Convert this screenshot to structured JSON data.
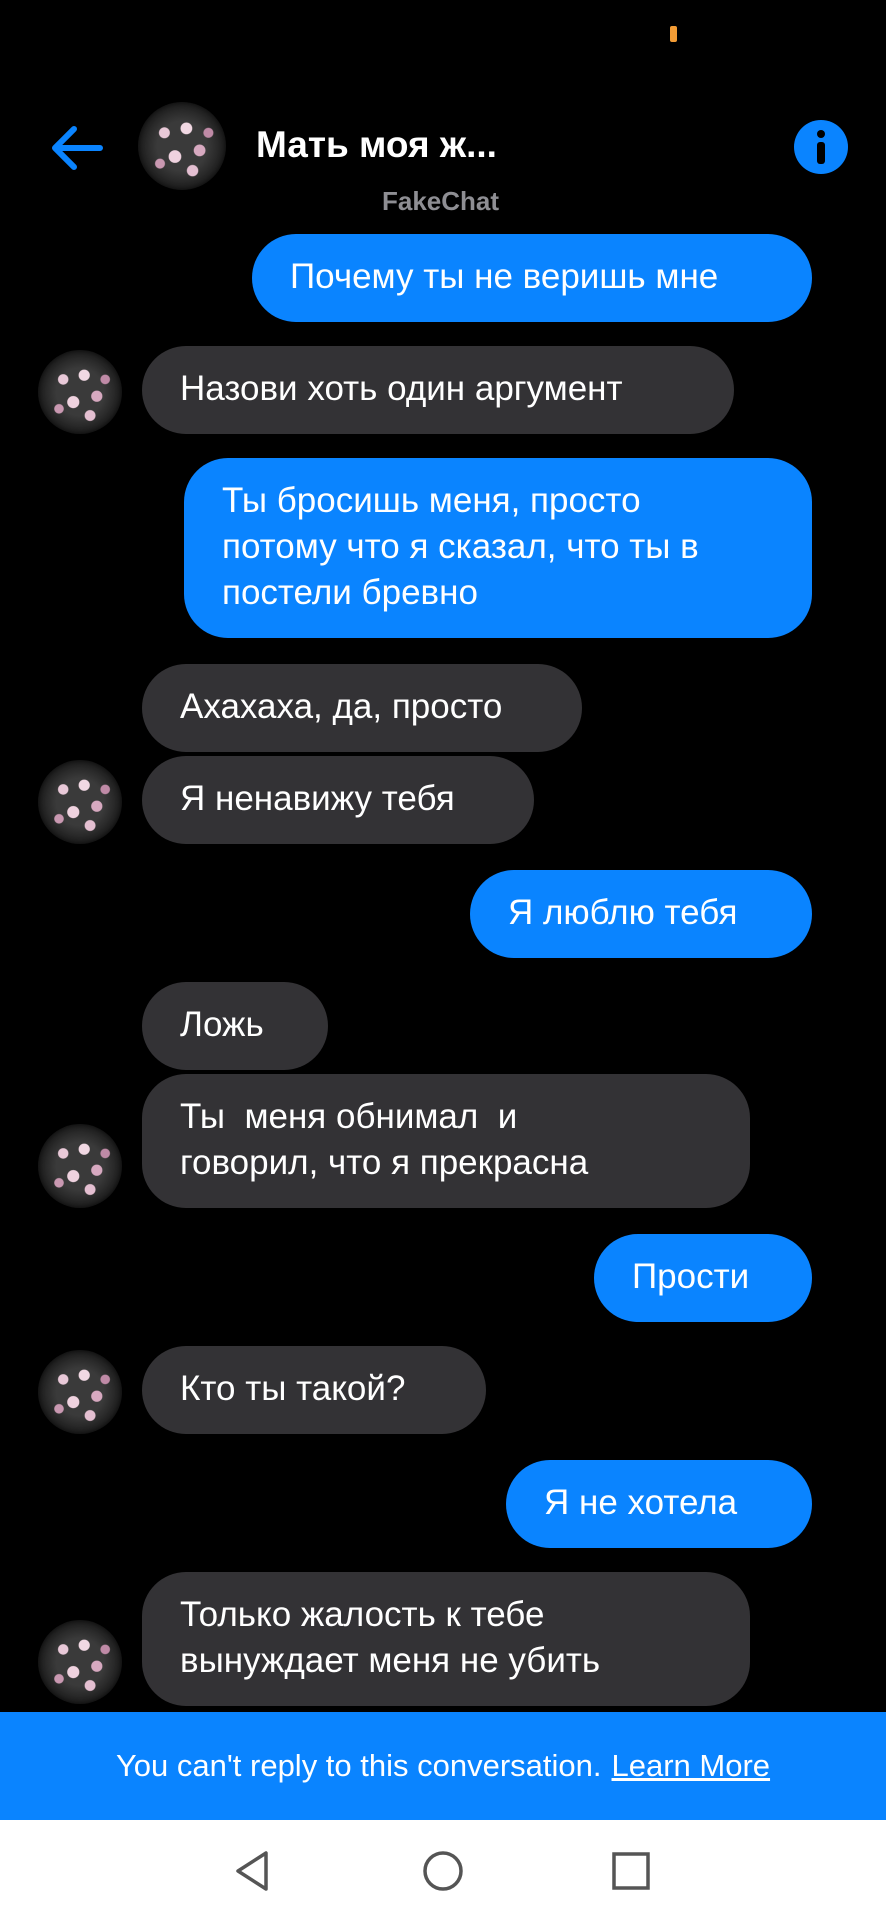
{
  "status_bar": {
    "indicator_color": "#f39c35"
  },
  "header": {
    "back_icon": "arrow-left-icon",
    "contact_name": "Мать моя ж...",
    "subtitle": "FakeChat",
    "info_icon": "info-icon"
  },
  "messages": [
    {
      "direction": "out",
      "text": "Почему ты не веришь мне"
    },
    {
      "direction": "in",
      "text": "Назови хоть один аргумент"
    },
    {
      "direction": "out",
      "text": "Ты бросишь меня, просто\nпотому что я сказал, что ты в\nпостели бревно"
    },
    {
      "direction": "in",
      "text": "Ахахаха, да, просто"
    },
    {
      "direction": "in",
      "text": "Я ненавижу тебя"
    },
    {
      "direction": "out",
      "text": "Я люблю тебя"
    },
    {
      "direction": "in",
      "text": "Ложь"
    },
    {
      "direction": "in",
      "text": "Ты  меня обнимал  и\nговорил, что я прекрасна"
    },
    {
      "direction": "out",
      "text": "Прости"
    },
    {
      "direction": "in",
      "text": "Кто ты такой?"
    },
    {
      "direction": "out",
      "text": "Я не хотела"
    },
    {
      "direction": "in",
      "text": "Только жалость к тебе\nвынуждает меня не убить"
    }
  ],
  "banner": {
    "text": "You can't reply to this conversation.",
    "link": "Learn More"
  },
  "nav": {
    "back_icon": "triangle-back-icon",
    "home_icon": "circle-home-icon",
    "recent_icon": "square-recents-icon"
  },
  "colors": {
    "background": "#000000",
    "outgoing_bubble": "#0a84ff",
    "incoming_bubble": "#333235",
    "accent": "#0a84ff"
  }
}
